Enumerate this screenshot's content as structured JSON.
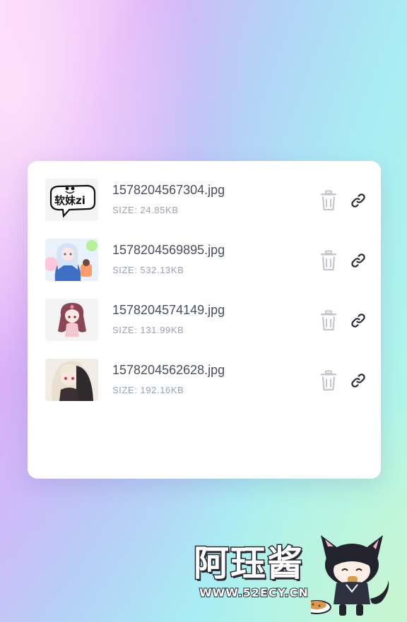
{
  "files": [
    {
      "name": "1578204567304.jpg",
      "size": "24.85KB",
      "thumb": "soft-text-sticker"
    },
    {
      "name": "1578204569895.jpg",
      "size": "532.13KB",
      "thumb": "anime-girl-blue"
    },
    {
      "name": "1578204574149.jpg",
      "size": "131.99KB",
      "thumb": "chibi-girl"
    },
    {
      "name": "1578204562628.jpg",
      "size": "192.16KB",
      "thumb": "anime-girl-pale"
    }
  ],
  "size_label": "SIZE:",
  "thumb_text": "软妹zi",
  "actions": {
    "delete_icon": "trash-icon",
    "link_icon": "link-icon"
  },
  "watermark": {
    "title": "阿珏酱",
    "url": "WWW.52ECY.CN"
  },
  "colors": {
    "card": "#ffffff",
    "filename": "#4a4f5c",
    "size": "#9aa1b0",
    "trash": "#c4c7ce",
    "link": "#2b2b33"
  }
}
